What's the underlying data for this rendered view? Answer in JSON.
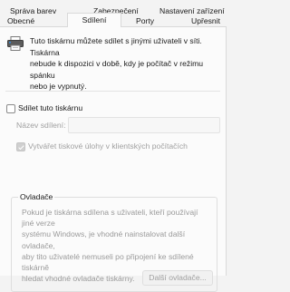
{
  "tabs": {
    "manage_colors": "Správa barev",
    "security": "Zabezpečení",
    "device_settings": "Nastavení zařízení",
    "general": "Obecné",
    "sharing": "Sdílení",
    "ports": "Porty",
    "advanced": "Upřesnit"
  },
  "sharing": {
    "info_line1": "Tuto tiskárnu můžete sdílet s jinými uživateli v síti. Tiskárna",
    "info_line2": "nebude k dispozici v době, kdy je počítač v režimu spánku",
    "info_line3": "nebo je vypnutý.",
    "share_checkbox_label": "Sdílet tuto tiskárnu",
    "share_name_label": "Název sdílení:",
    "share_name_value": "",
    "render_jobs_label": "Vytvářet tiskové úlohy v klientských počítačích"
  },
  "drivers": {
    "title": "Ovladače",
    "text_line1": "Pokud je tiskárna sdílena s uživateli, kteří používají jiné verze",
    "text_line2": "systému Windows, je vhodné nainstalovat další ovladače,",
    "text_line3": "aby tito uživatelé nemuseli po připojení ke sdílené tiskárně",
    "text_line4": "hledat vhodné ovladače tiskárny.",
    "button_label": "Další ovladače..."
  },
  "icons": {
    "printer": "printer-icon"
  },
  "colors": {
    "background": "#f3f3f3",
    "panel": "#fbfbfb",
    "disabled_text": "#a0a0a0"
  }
}
